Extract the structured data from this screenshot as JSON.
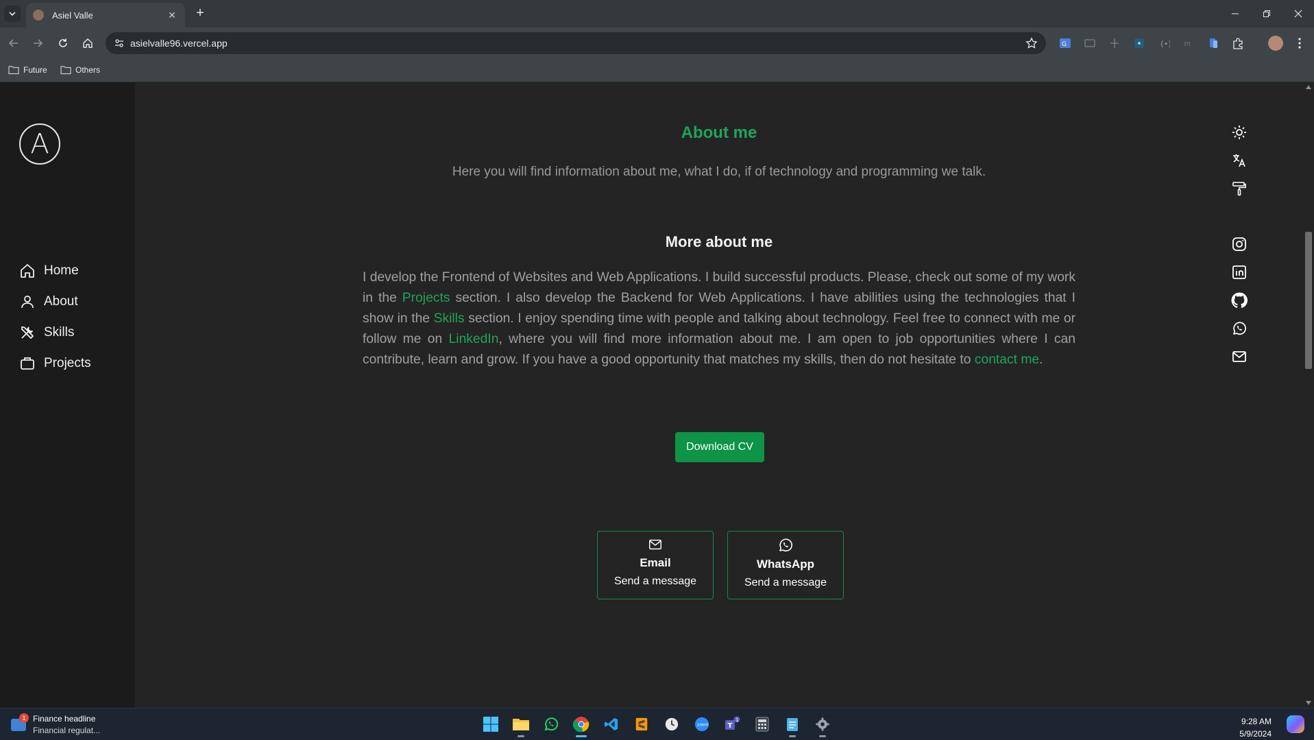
{
  "browser": {
    "tab_title": "Asiel Valle",
    "url": "asielvalle96.vercel.app",
    "bookmarks": [
      "Future",
      "Others"
    ]
  },
  "sidebar": {
    "logo_letter": "A",
    "nav": [
      "Home",
      "About",
      "Skills",
      "Projects"
    ]
  },
  "main": {
    "heading": "About me",
    "subtitle": "Here you will find information about me, what I do, if of technology and programming we talk.",
    "more_heading": "More about me",
    "paragraph": {
      "p1": "I develop the Frontend of Websites and Web Applications. I build successful products. Please, check out some of my work in the ",
      "link_projects": "Projects",
      "p2": " section. I also develop the Backend for Web Applications. I have abilities using the technologies that I show in the ",
      "link_skills": "Skills",
      "p3": " section. I enjoy spending time with people and talking about technology. Feel free to connect with me or follow me on ",
      "link_linkedin": "LinkedIn",
      "p4": ", where you will find more information about me. I am open to job opportunities where I can contribute, learn and grow. If you have a good opportunity that matches my skills, then do not hesitate to ",
      "link_contact": "contact me",
      "p5": "."
    },
    "cv_button": "Download CV",
    "cards": [
      {
        "title": "Email",
        "subtitle": "Send a message"
      },
      {
        "title": "WhatsApp",
        "subtitle": "Send a message"
      }
    ]
  },
  "right_icons": [
    "sun-icon",
    "translate-icon",
    "paint-roller-icon",
    "instagram-icon",
    "linkedin-icon",
    "github-icon",
    "whatsapp-icon",
    "mail-icon"
  ],
  "taskbar": {
    "news_title": "Finance headline",
    "news_sub": "Financial regulat...",
    "news_badge": "1",
    "teams_badge": "1",
    "time": "9:28 AM",
    "date": "5/9/2024"
  },
  "colors": {
    "accent": "#1ea55a",
    "button": "#0d9447",
    "sidebar": "#1b1b1b",
    "page": "#242424"
  }
}
